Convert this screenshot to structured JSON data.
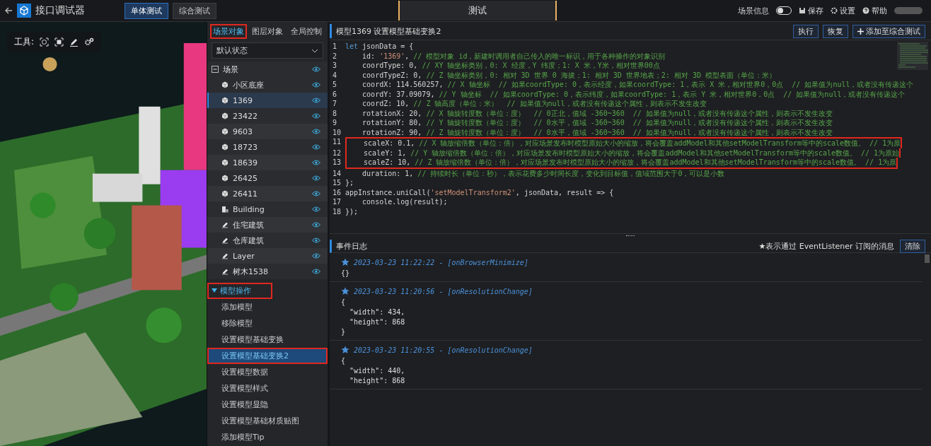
{
  "app": {
    "title": "接口调试器"
  },
  "modes": [
    {
      "label": "单体测试",
      "selected": true
    },
    {
      "label": "综合测试",
      "selected": false
    }
  ],
  "page_title": "测试",
  "header_actions": {
    "scene_info": {
      "label": "场景信息",
      "on": false
    },
    "buttons": [
      {
        "kind": "save",
        "label": "保存"
      },
      {
        "kind": "settings",
        "label": "设置"
      },
      {
        "kind": "help",
        "label": "帮助"
      }
    ]
  },
  "viewport": {
    "kind": "picture",
    "toolbar_label": "工具:"
  },
  "panel_tabs": [
    {
      "label": "场景对象",
      "selected": true,
      "marked": true
    },
    {
      "label": "图层对象",
      "selected": false,
      "marked": false
    },
    {
      "label": "全局控制",
      "selected": false,
      "marked": false
    }
  ],
  "state_select": {
    "value": "默认状态"
  },
  "tree": {
    "label": "场景",
    "expanded": true,
    "children": [
      {
        "label": "小区底座",
        "kind": "model",
        "selected": false
      },
      {
        "label": "1369",
        "kind": "model",
        "selected": true
      },
      {
        "label": "23422",
        "kind": "model",
        "selected": false
      },
      {
        "label": "9603",
        "kind": "model",
        "selected": false
      },
      {
        "label": "18723",
        "kind": "model",
        "selected": false
      },
      {
        "label": "18639",
        "kind": "model",
        "selected": false
      },
      {
        "label": "26425",
        "kind": "model",
        "selected": false
      },
      {
        "label": "26411",
        "kind": "model",
        "selected": false
      },
      {
        "label": "Building",
        "kind": "building",
        "selected": false
      },
      {
        "label": "住宅建筑",
        "kind": "layer",
        "selected": false
      },
      {
        "label": "仓库建筑",
        "kind": "layer",
        "selected": false
      },
      {
        "label": "Layer",
        "kind": "layer",
        "selected": false
      },
      {
        "label": "树木1538",
        "kind": "layer",
        "selected": false
      }
    ]
  },
  "section": {
    "label": "模型操作",
    "expanded": true,
    "marked": true,
    "items": [
      {
        "label": "添加模型",
        "selected": false,
        "marked": false
      },
      {
        "label": "移除模型",
        "selected": false,
        "marked": false
      },
      {
        "label": "设置模型基础变换",
        "selected": false,
        "marked": false
      },
      {
        "label": "设置模型基础变换2",
        "selected": true,
        "marked": true
      },
      {
        "label": "设置模型数据",
        "selected": false,
        "marked": false
      },
      {
        "label": "设置模型样式",
        "selected": false,
        "marked": false
      },
      {
        "label": "设置模型显隐",
        "selected": false,
        "marked": false
      },
      {
        "label": "设置模型基础材质贴图",
        "selected": false,
        "marked": false
      },
      {
        "label": "添加模型Tip",
        "selected": false,
        "marked": false
      }
    ]
  },
  "editor": {
    "title": "模型1369 设置模型基础变换2",
    "buttons": [
      {
        "label": "执行",
        "kind": "plain"
      },
      {
        "label": "恢复",
        "kind": "plain"
      },
      {
        "label": "添加至综合测试",
        "kind": "add"
      }
    ],
    "lines": [
      {
        "n": "1",
        "marked": false,
        "segs": [
          {
            "kind": "kw",
            "text": "let"
          },
          {
            "kind": "plain",
            "text": " jsonData = {"
          }
        ]
      },
      {
        "n": "2",
        "marked": false,
        "segs": [
          {
            "kind": "plain",
            "text": "    id: "
          },
          {
            "kind": "str",
            "text": "'1369'"
          },
          {
            "kind": "plain",
            "text": ", "
          },
          {
            "kind": "comment",
            "text": "// 模型对象 id，新建时调用者自己传入的唯一标识，用于各种操作的对象识别"
          }
        ]
      },
      {
        "n": "3",
        "marked": false,
        "segs": [
          {
            "kind": "plain",
            "text": "    coordType: 0, "
          },
          {
            "kind": "comment",
            "text": "// XY 轴坐标类别，0: X 经度，Y 纬度；1: X 米，Y米，相对世界00点"
          }
        ]
      },
      {
        "n": "4",
        "marked": false,
        "segs": [
          {
            "kind": "plain",
            "text": "    coordTypeZ: 0, "
          },
          {
            "kind": "comment",
            "text": "// Z 轴坐标类别，0: 相对 3D 世界 0 海拔；1: 相对 3D 世界地表；2: 相对 3D 模型表面（单位：米）"
          }
        ]
      },
      {
        "n": "5",
        "marked": false,
        "segs": [
          {
            "kind": "plain",
            "text": "    coordX: 114.560257, "
          },
          {
            "kind": "comment",
            "text": "// X 轴坐标  // 如果coordType: 0，表示经度，如果coordType: 1，表示 X 米，相对世界0，0点  // 如果值为null，或者没有传递这个"
          }
        ]
      },
      {
        "n": "6",
        "marked": false,
        "segs": [
          {
            "kind": "plain",
            "text": "    coordY: 37.09079, "
          },
          {
            "kind": "comment",
            "text": "// Y 轴坐标  // 如果coordType: 0，表示纬度，如果coordType: 1，表示 Y 米，相对世界0，0点  // 如果值为null，或者没有传递这个"
          }
        ]
      },
      {
        "n": "7",
        "marked": false,
        "segs": [
          {
            "kind": "plain",
            "text": "    coordZ: 10, "
          },
          {
            "kind": "comment",
            "text": "// Z 轴高度（单位：米）  // 如果值为null，或者没有传递这个属性，则表示不发生改变"
          }
        ]
      },
      {
        "n": "8",
        "marked": false,
        "segs": [
          {
            "kind": "plain",
            "text": "    rotationX: 20, "
          },
          {
            "kind": "comment",
            "text": "// X 轴旋转度数（单位：度）  // 0正北，值域 -360~360  // 如果值为null，或者没有传递这个属性，则表示不发生改变"
          }
        ]
      },
      {
        "n": "9",
        "marked": false,
        "segs": [
          {
            "kind": "plain",
            "text": "    rotationY: 80, "
          },
          {
            "kind": "comment",
            "text": "// Y 轴旋转度数（单位：度）  // 0水平，值域 -360~360  // 如果值为null，或者没有传递这个属性，则表示不发生改变"
          }
        ]
      },
      {
        "n": "10",
        "marked": false,
        "segs": [
          {
            "kind": "plain",
            "text": "    rotationZ: 90, "
          },
          {
            "kind": "comment",
            "text": "// Z 轴旋转度数（单位：度）  // 0水平，值域 -360~360  // 如果值为null，或者没有传递这个属性，则表示不发生改变"
          }
        ]
      },
      {
        "n": "11",
        "marked": true,
        "segs": [
          {
            "kind": "plain",
            "text": "    scaleX: 0.1, "
          },
          {
            "kind": "comment",
            "text": "// X 轴放缩倍数（单位：倍），对应场景发布时模型原始大小的缩放，将会覆盖addModel和其他setModelTransform等中的scale数值。 // 1为原"
          }
        ]
      },
      {
        "n": "12",
        "marked": true,
        "segs": [
          {
            "kind": "plain",
            "text": "    scaleY: 1, "
          },
          {
            "kind": "comment",
            "text": "// Y 轴放缩倍数（单位：倍），对应场景发布时模型原始大小的缩放，将会覆盖addModel和其他setModelTransform等中的scale数值。 // 1为原始"
          }
        ]
      },
      {
        "n": "13",
        "marked": true,
        "segs": [
          {
            "kind": "plain",
            "text": "    scaleZ: 10, "
          },
          {
            "kind": "comment",
            "text": "// Z 轴放缩倍数（单位：倍），对应场景发布时模型原始大小的缩放，将会覆盖addModel和其他setModelTransform等中的scale数值。 // 1为原"
          }
        ]
      },
      {
        "n": "14",
        "marked": false,
        "segs": [
          {
            "kind": "plain",
            "text": "    duration: 1, "
          },
          {
            "kind": "comment",
            "text": "// 持续时长（单位：秒），表示花费多少时间长度，变化到目标值，值域范围大于0，可以是小数"
          }
        ]
      },
      {
        "n": "15",
        "marked": false,
        "segs": [
          {
            "kind": "plain",
            "text": "};"
          }
        ]
      },
      {
        "n": "16",
        "marked": false,
        "segs": [
          {
            "kind": "plain",
            "text": "appInstance.uniCall("
          },
          {
            "kind": "str",
            "text": "'setModelTransform2'"
          },
          {
            "kind": "plain",
            "text": ", jsonData, result => {"
          }
        ]
      },
      {
        "n": "17",
        "marked": false,
        "segs": [
          {
            "kind": "plain",
            "text": "    console.log(result);"
          }
        ]
      },
      {
        "n": "18",
        "marked": false,
        "segs": [
          {
            "kind": "plain",
            "text": "});"
          }
        ]
      }
    ]
  },
  "log": {
    "title": "事件日志",
    "legend": "★表示通过 EventListener 订阅的消息",
    "clear_button": "清除",
    "entries": [
      {
        "starred": true,
        "time": "2023-03-23 11:22:22 - [onBrowserMinimize]",
        "body": [
          "{}"
        ]
      },
      {
        "starred": true,
        "time": "2023-03-23 11:20:56 - [onResolutionChange]",
        "body": [
          "{",
          "  \"width\": 434,",
          "  \"height\": 868",
          "}"
        ]
      },
      {
        "starred": true,
        "time": "2023-03-23 11:20:55 - [onResolutionChange]",
        "body": [
          "{",
          "  \"width\": 440,",
          "  \"height\": 868"
        ]
      }
    ]
  }
}
